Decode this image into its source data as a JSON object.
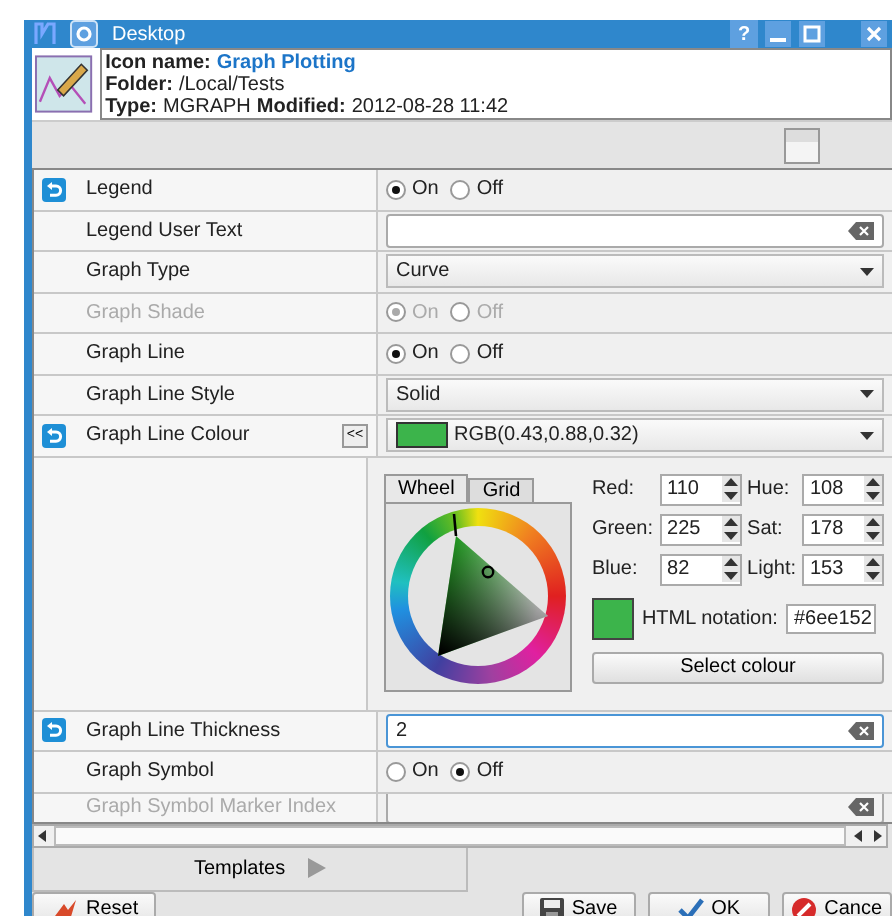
{
  "window": {
    "title": "Desktop",
    "help": "?"
  },
  "header": {
    "lines": [
      [
        {
          "label": "Icon name:",
          "value": "Graph Plotting",
          "link": true
        }
      ],
      [
        {
          "label": "Folder:",
          "value": "/Local/Tests",
          "link": false
        }
      ],
      [
        {
          "label": "Type:",
          "value": "MGRAPH",
          "link": false
        },
        {
          "label": "Modified:",
          "value": "2012-08-28 11:42",
          "link": false
        }
      ]
    ]
  },
  "rows": [
    {
      "kind": "radio",
      "label": "Legend",
      "reset": true,
      "disabled": false,
      "options": [
        {
          "label": "On",
          "selected": true
        },
        {
          "label": "Off",
          "selected": false
        }
      ]
    },
    {
      "kind": "text",
      "label": "Legend User Text",
      "reset": false,
      "disabled": false,
      "value": "",
      "focused": false
    },
    {
      "kind": "dropdown",
      "label": "Graph Type",
      "reset": false,
      "disabled": false,
      "value": "Curve"
    },
    {
      "kind": "radio",
      "label": "Graph Shade",
      "reset": false,
      "disabled": true,
      "options": [
        {
          "label": "On",
          "selected": true
        },
        {
          "label": "Off",
          "selected": false
        }
      ]
    },
    {
      "kind": "radio",
      "label": "Graph Line",
      "reset": false,
      "disabled": false,
      "options": [
        {
          "label": "On",
          "selected": true
        },
        {
          "label": "Off",
          "selected": false
        }
      ]
    },
    {
      "kind": "dropdown",
      "label": "Graph Line Style",
      "reset": false,
      "disabled": false,
      "value": "Solid"
    },
    {
      "kind": "colour",
      "label": "Graph Line Colour",
      "reset": true,
      "disabled": false,
      "value": "RGB(0.43,0.88,0.32)",
      "collapse": "<<",
      "picker": {
        "tabs": [
          {
            "label": "Wheel",
            "selected": true
          },
          {
            "label": "Grid",
            "selected": false
          }
        ],
        "fields": [
          {
            "label": "Red:",
            "value": "110"
          },
          {
            "label": "Hue:",
            "value": "108"
          },
          {
            "label": "Green:",
            "value": "225"
          },
          {
            "label": "Sat:",
            "value": "178"
          },
          {
            "label": "Blue:",
            "value": "82"
          },
          {
            "label": "Light:",
            "value": "153"
          }
        ],
        "html_label": "HTML notation:",
        "html_value": "#6ee152",
        "button": "Select colour"
      }
    },
    {
      "kind": "text",
      "label": "Graph Line Thickness",
      "reset": true,
      "disabled": false,
      "value": "2",
      "focused": true
    },
    {
      "kind": "radio",
      "label": "Graph Symbol",
      "reset": false,
      "disabled": false,
      "options": [
        {
          "label": "On",
          "selected": false
        },
        {
          "label": "Off",
          "selected": true
        }
      ]
    },
    {
      "kind": "text",
      "label": "Graph Symbol Marker Index",
      "reset": false,
      "disabled": true,
      "value": "",
      "focused": false
    }
  ],
  "tabs": [
    {
      "label": "Templates",
      "selected": true
    }
  ],
  "buttons": [
    {
      "kind": "reset",
      "label": "Reset"
    },
    {
      "kind": "save",
      "label": "Save"
    },
    {
      "kind": "ok",
      "label": "OK"
    },
    {
      "kind": "cancel",
      "label": "Cance"
    }
  ]
}
